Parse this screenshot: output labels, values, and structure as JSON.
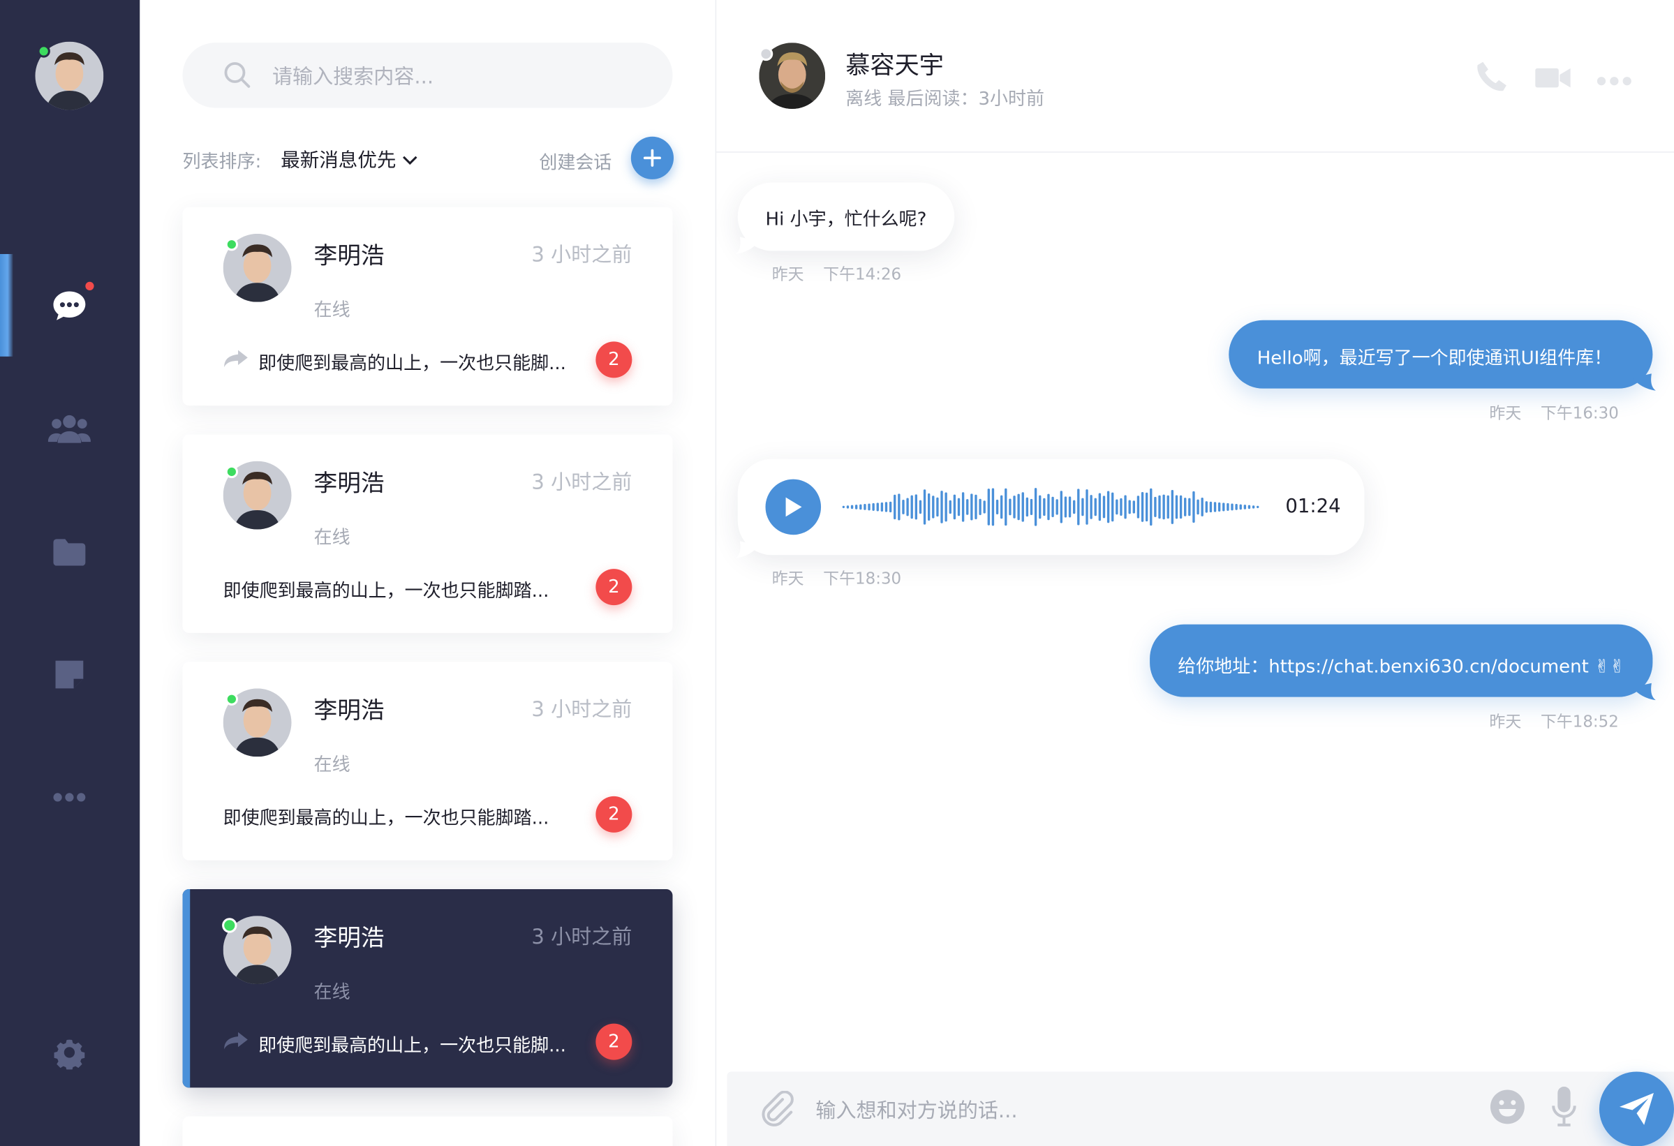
{
  "nav": {
    "items": [
      "chat-icon",
      "users-icon",
      "folder-icon",
      "note-icon",
      "more-icon"
    ],
    "settings": "gear-icon",
    "accent": "#4a90d9",
    "online_color": "#3ddc5f"
  },
  "sidebar": {
    "search_placeholder": "请输入搜索内容...",
    "sort_label": "列表排序:",
    "sort_value": "最新消息优先",
    "create_label": "创建会话",
    "conversations": [
      {
        "name": "李明浩",
        "time": "3 小时之前",
        "status": "在线",
        "message": "即使爬到最高的山上，一次也只能脚...",
        "unread": "2",
        "forwarded": true,
        "active": false
      },
      {
        "name": "李明浩",
        "time": "3 小时之前",
        "status": "在线",
        "message": "即使爬到最高的山上，一次也只能脚踏...",
        "unread": "2",
        "forwarded": false,
        "active": false
      },
      {
        "name": "李明浩",
        "time": "3 小时之前",
        "status": "在线",
        "message": "即使爬到最高的山上，一次也只能脚踏...",
        "unread": "2",
        "forwarded": false,
        "active": false
      },
      {
        "name": "李明浩",
        "time": "3 小时之前",
        "status": "在线",
        "message": "即使爬到最高的山上，一次也只能脚...",
        "unread": "2",
        "forwarded": true,
        "active": true
      }
    ]
  },
  "chat": {
    "contact_name": "慕容天宇",
    "contact_status": "离线 最后阅读：3小时前",
    "messages": [
      {
        "dir": "in",
        "type": "text",
        "text": "Hi 小宇，忙什么呢?",
        "day": "昨天",
        "time": "下午14:26"
      },
      {
        "dir": "out",
        "type": "text",
        "text": "Hello啊，最近写了一个即使通讯UI组件库！",
        "day": "昨天",
        "time": "下午16:30"
      },
      {
        "dir": "in",
        "type": "voice",
        "duration": "01:24",
        "day": "昨天",
        "time": "下午18:30"
      },
      {
        "dir": "out",
        "type": "text",
        "text": "给你地址：https://chat.benxi630.cn/document ✌✌",
        "day": "昨天",
        "time": "下午18:52"
      }
    ],
    "composer_placeholder": "输入想和对方说的话..."
  }
}
